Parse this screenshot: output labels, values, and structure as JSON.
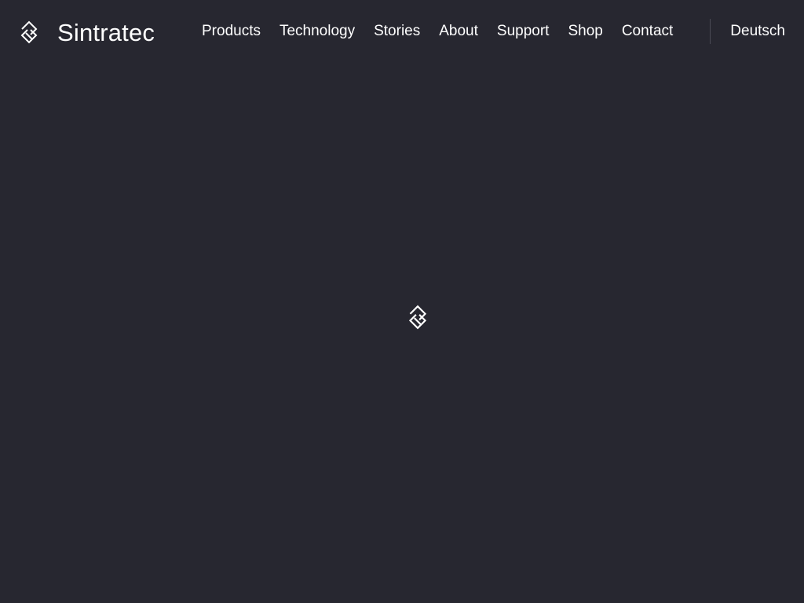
{
  "brand": {
    "name": "Sintratec",
    "icon": "sintratec-logo-icon"
  },
  "nav": {
    "items": [
      {
        "label": "Products"
      },
      {
        "label": "Technology"
      },
      {
        "label": "Stories"
      },
      {
        "label": "About"
      },
      {
        "label": "Support"
      },
      {
        "label": "Shop"
      },
      {
        "label": "Contact"
      }
    ]
  },
  "language": {
    "label": "Deutsch"
  },
  "loader": {
    "icon": "sintratec-logo-icon"
  },
  "colors": {
    "background": "#272730",
    "text": "#ffffff",
    "divider": "#4a4a55"
  }
}
